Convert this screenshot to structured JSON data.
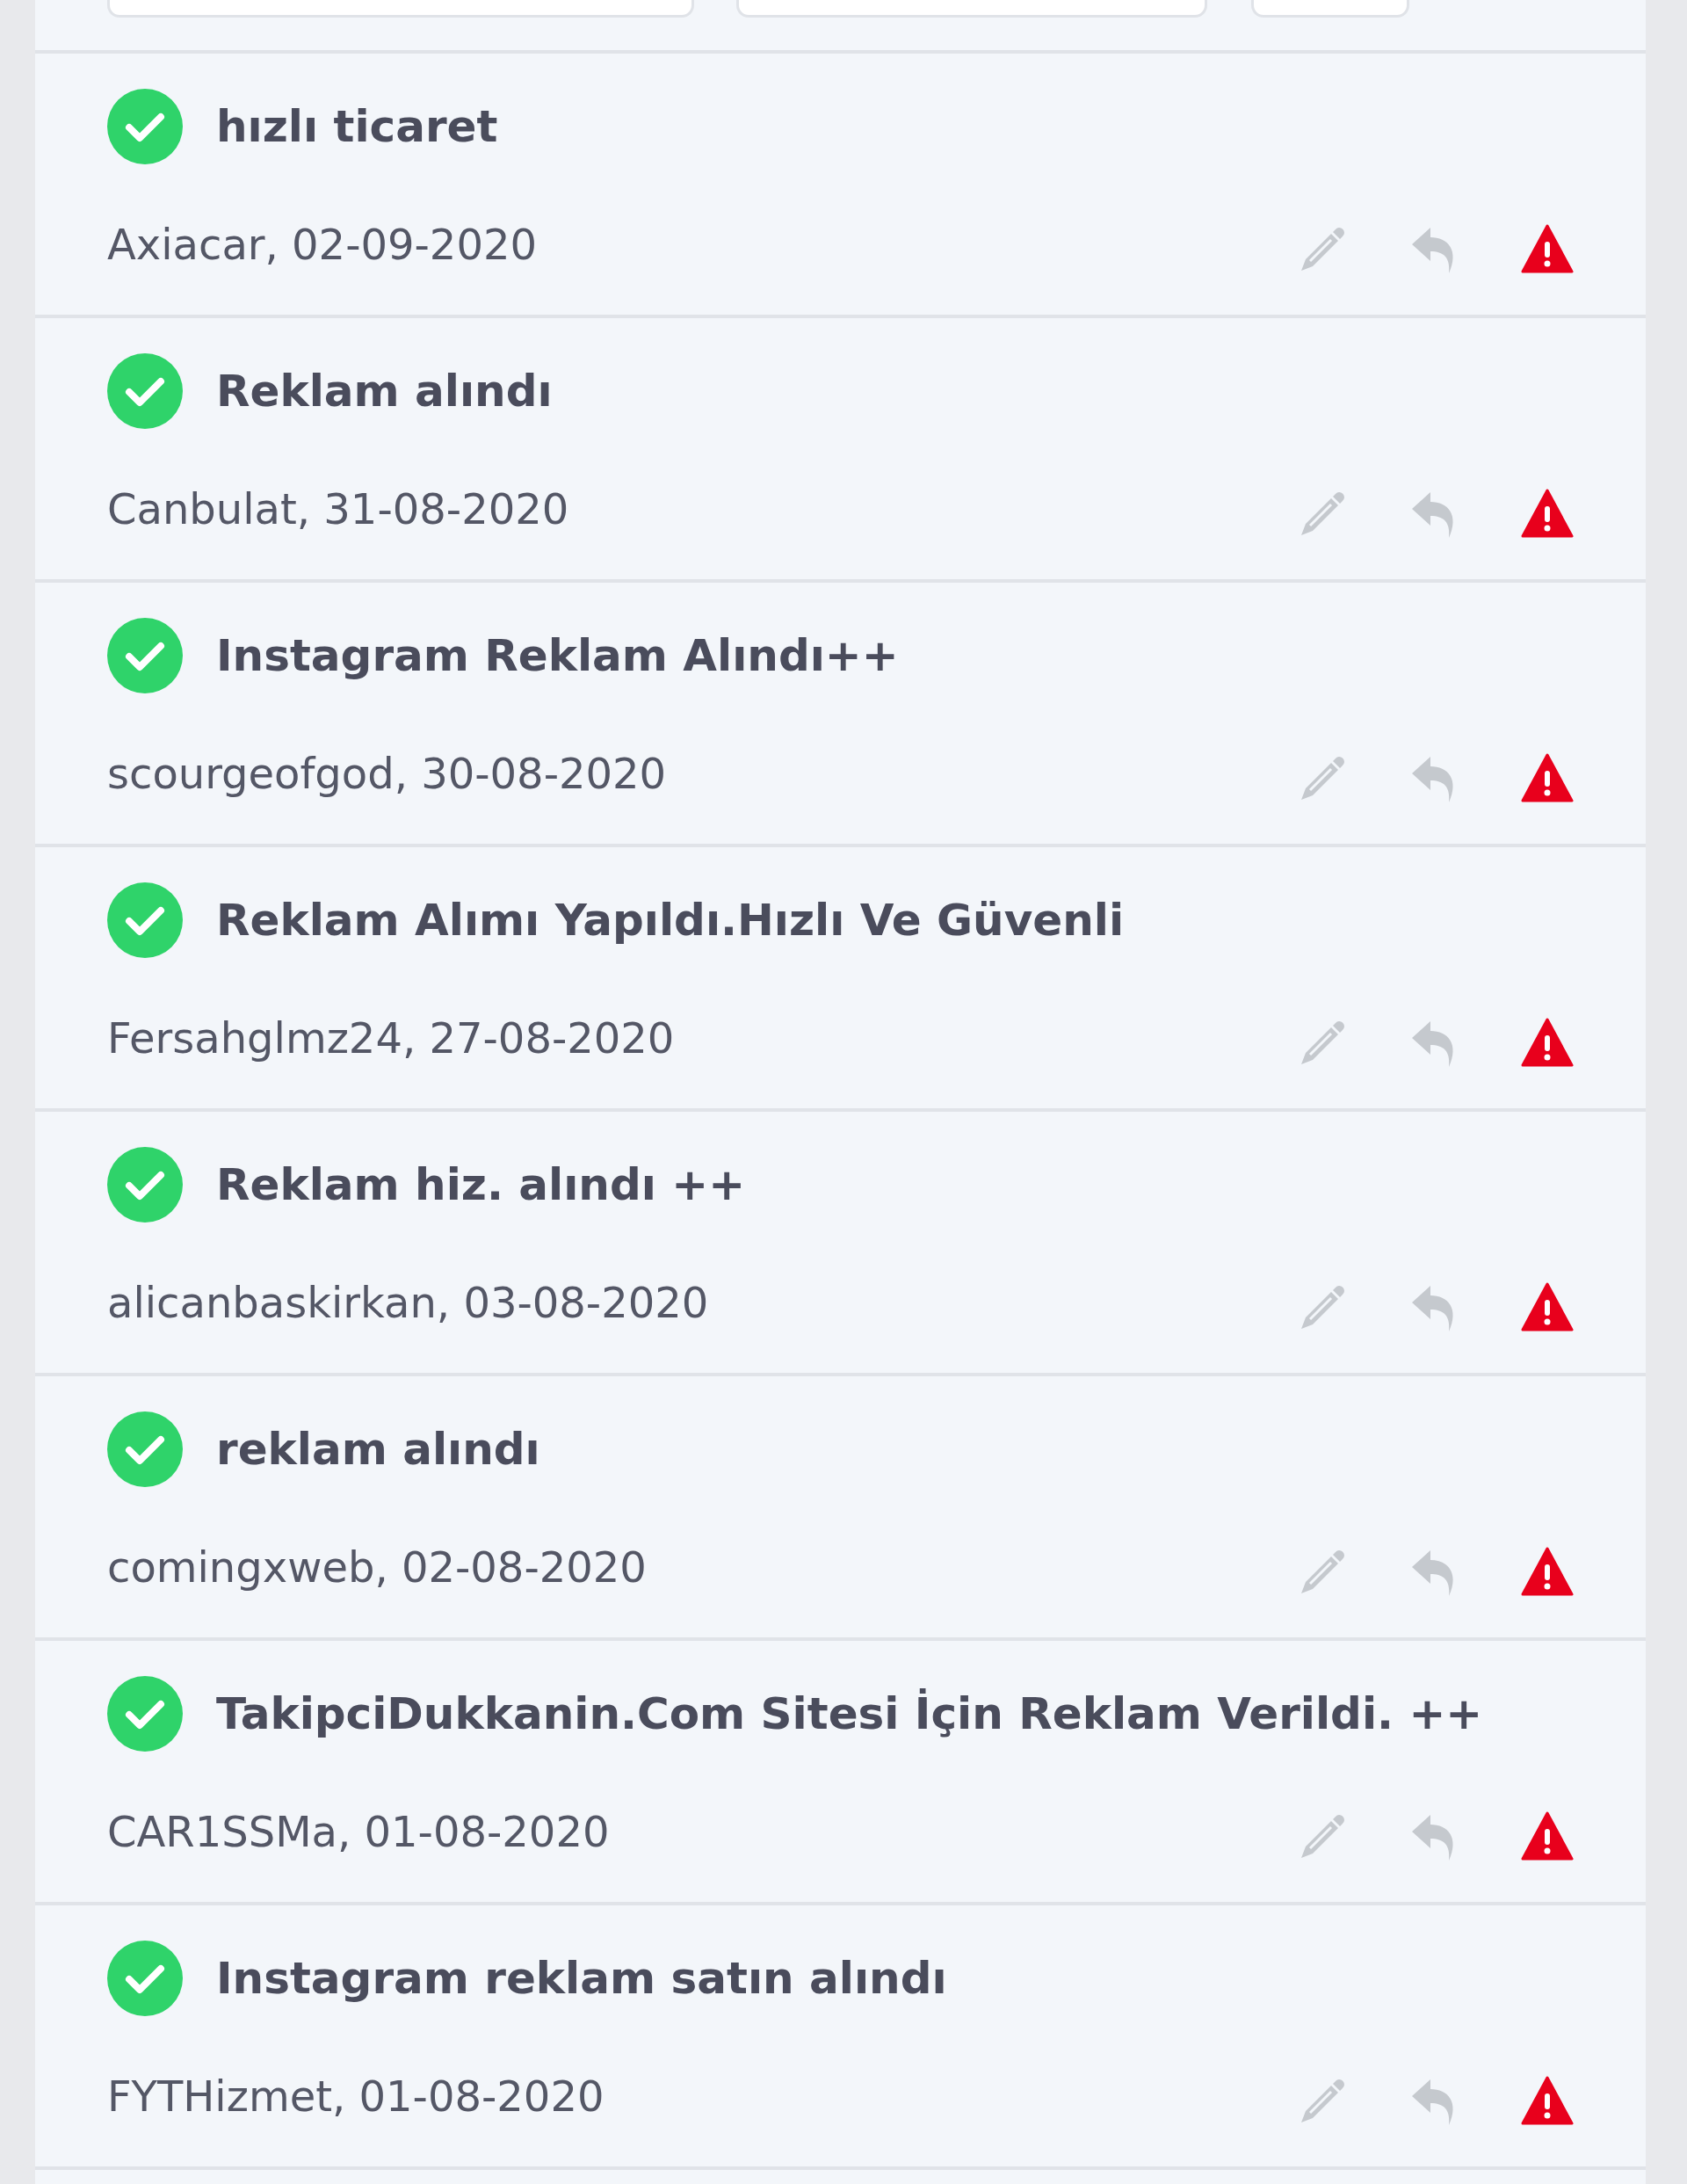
{
  "reviews": [
    {
      "verified": true,
      "title": "hızlı ticaret",
      "byline": "Axiacar, 02-09-2020"
    },
    {
      "verified": true,
      "title": "Reklam alındı",
      "byline": "Canbulat, 31-08-2020"
    },
    {
      "verified": true,
      "title": "Instagram Reklam Alındı++",
      "byline": "scourgeofgod, 30-08-2020"
    },
    {
      "verified": true,
      "title": "Reklam Alımı Yapıldı.Hızlı Ve Güvenli",
      "byline": "Fersahglmz24, 27-08-2020"
    },
    {
      "verified": true,
      "title": "Reklam hiz. alındı ++",
      "byline": "alicanbaskirkan, 03-08-2020"
    },
    {
      "verified": true,
      "title": "reklam alındı",
      "byline": "comingxweb, 02-08-2020"
    },
    {
      "verified": true,
      "title": "TakipciDukkanin.Com Sitesi İçin Reklam Verildi. ++",
      "byline": "CAR1SSMa, 01-08-2020"
    },
    {
      "verified": true,
      "title": "Instagram reklam satın alındı",
      "byline": "FYTHizmet, 01-08-2020"
    }
  ]
}
